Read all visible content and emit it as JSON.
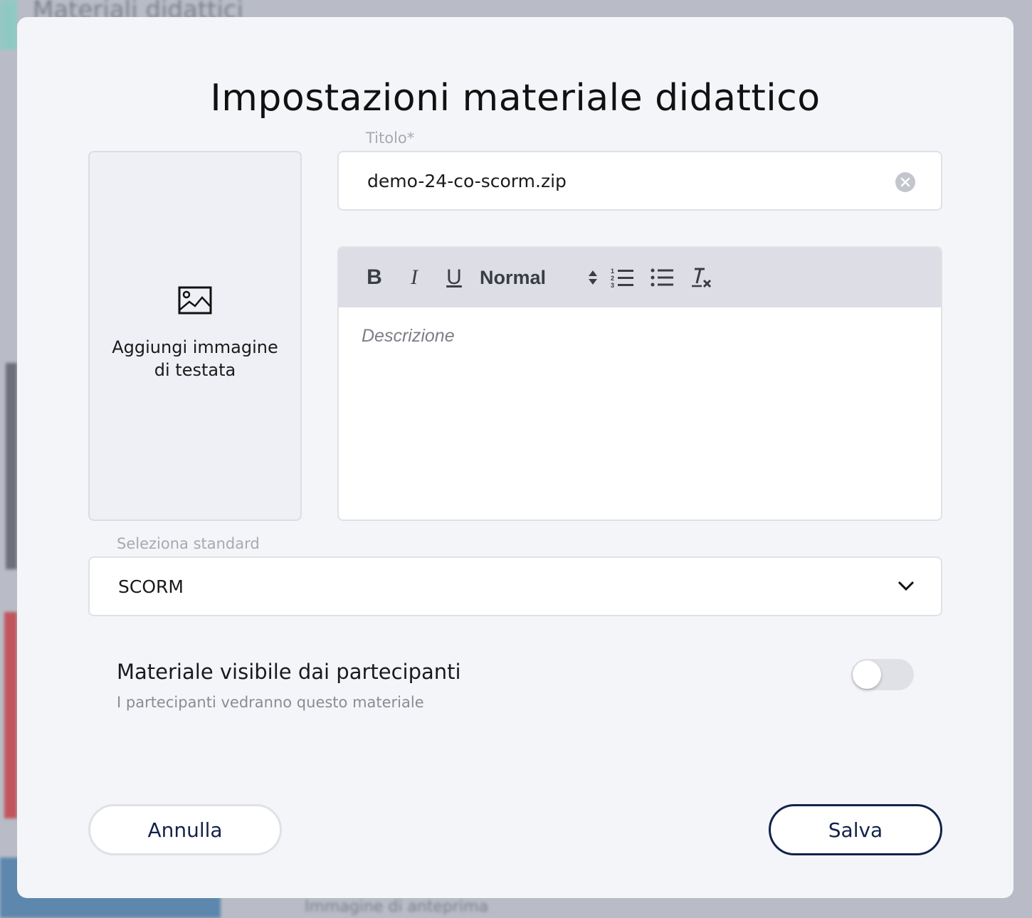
{
  "background": {
    "page_title": "Materiali didattici",
    "bottom_text": "Immagine di anteprima"
  },
  "modal": {
    "title": "Impostazioni materiale didattico",
    "header_image": {
      "label": "Aggiungi immagine di testata",
      "icon": "image-icon"
    },
    "title_field": {
      "label": "Titolo*",
      "value": "demo-24-co-scorm.zip",
      "clear_icon": "clear-circle-icon"
    },
    "editor": {
      "toolbar": {
        "bold": "B",
        "italic": "I",
        "underline": "U",
        "heading_select": "Normal",
        "ordered_list_icon": "ordered-list-icon",
        "bullet_list_icon": "bullet-list-icon",
        "clear_format_icon": "clear-format-icon"
      },
      "placeholder": "Descrizione"
    },
    "standard_field": {
      "label": "Seleziona standard",
      "value": "SCORM"
    },
    "visibility": {
      "title": "Materiale visibile dai partecipanti",
      "subtitle": "I partecipanti vedranno questo materiale",
      "enabled": false
    },
    "buttons": {
      "cancel": "Annulla",
      "save": "Salva"
    }
  },
  "colors": {
    "overlay": "#b9bcc6",
    "modal_bg": "#f4f5f9",
    "toolbar_bg": "#dcdde5",
    "primary_text": "#13224a",
    "toggle_off": "#e0e1e7"
  }
}
